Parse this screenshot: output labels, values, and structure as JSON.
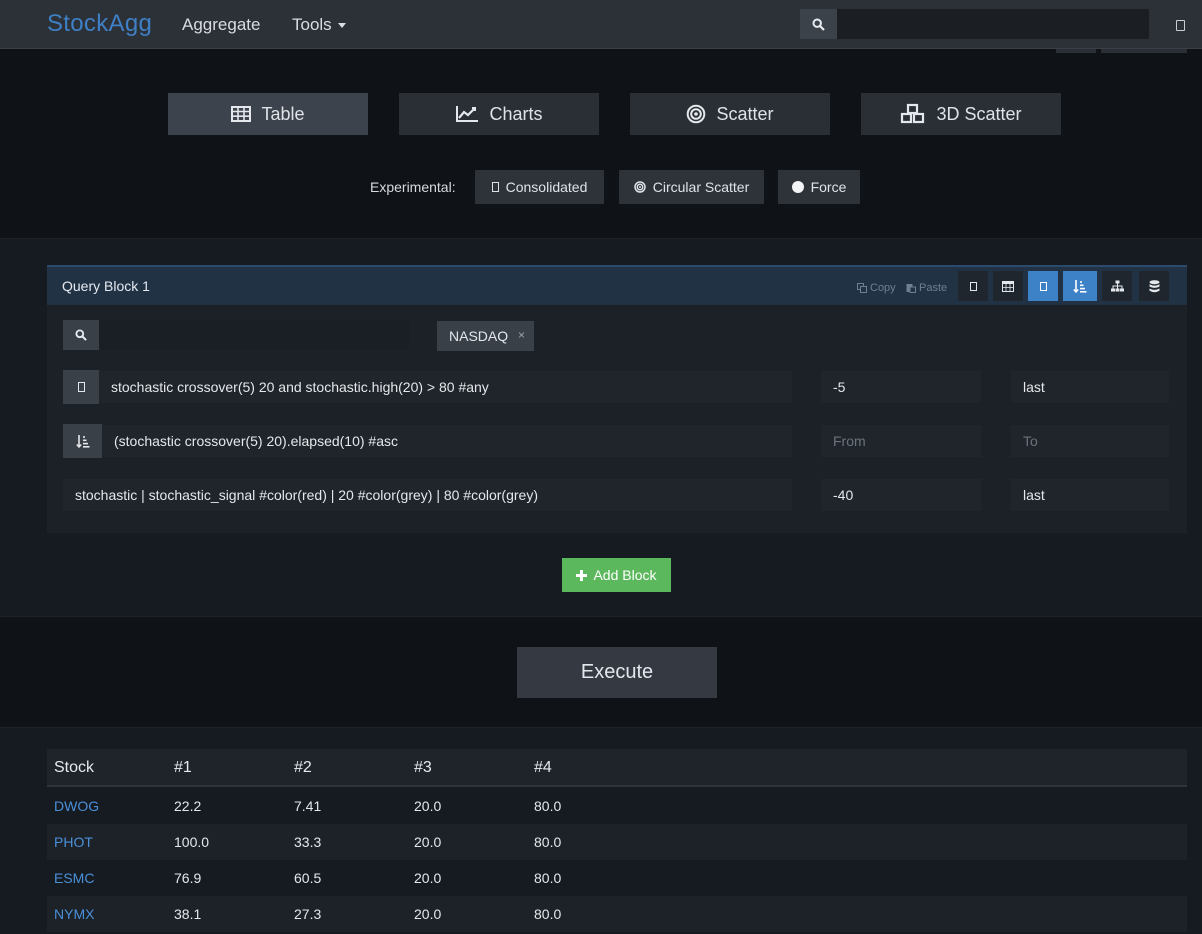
{
  "navbar": {
    "brand": "StockAgg",
    "links": [
      "Aggregate",
      "Tools"
    ],
    "search_value": ""
  },
  "views": [
    {
      "label": "Table",
      "icon": "table-icon",
      "active": true
    },
    {
      "label": "Charts",
      "icon": "line-chart-icon",
      "active": false
    },
    {
      "label": "Scatter",
      "icon": "target-icon",
      "active": false
    },
    {
      "label": "3D Scatter",
      "icon": "cubes-icon",
      "active": false
    }
  ],
  "experimental": {
    "label": "Experimental:",
    "buttons": [
      {
        "label": "Consolidated",
        "icon": "square-icon"
      },
      {
        "label": "Circular Scatter",
        "icon": "target-icon"
      },
      {
        "label": "Force",
        "icon": "circle-icon"
      }
    ]
  },
  "query_block": {
    "title": "Query Block 1",
    "copy_label": "Copy",
    "paste_label": "Paste",
    "tools": [
      {
        "icon": "square-icon",
        "active": false
      },
      {
        "icon": "calendar-icon",
        "active": false
      },
      {
        "icon": "square-icon",
        "active": true
      },
      {
        "icon": "sort-asc-icon",
        "active": true
      },
      {
        "icon": "sitemap-icon",
        "active": false
      },
      {
        "icon": "database-icon",
        "active": false
      }
    ],
    "search_value": "",
    "tag": "NASDAQ",
    "rows": [
      {
        "icon": "square-icon",
        "expression": "stochastic crossover(5) 20 and stochastic.high(20) > 80 #any",
        "from": "-5",
        "to": "last"
      },
      {
        "icon": "sort-asc-icon",
        "expression": "(stochastic crossover(5) 20).elapsed(10) #asc",
        "from_placeholder": "From",
        "to_placeholder": "To"
      },
      {
        "icon": "",
        "expression": "stochastic | stochastic_signal #color(red) | 20 #color(grey) | 80 #color(grey)",
        "from": "-40",
        "to": "last"
      }
    ]
  },
  "add_block_label": "Add Block",
  "execute_label": "Execute",
  "results": {
    "headers": [
      "Stock",
      "#1",
      "#2",
      "#3",
      "#4"
    ],
    "rows": [
      [
        "DWOG",
        "22.2",
        "7.41",
        "20.0",
        "80.0"
      ],
      [
        "PHOT",
        "100.0",
        "33.3",
        "20.0",
        "80.0"
      ],
      [
        "ESMC",
        "76.9",
        "60.5",
        "20.0",
        "80.0"
      ],
      [
        "NYMX",
        "38.1",
        "27.3",
        "20.0",
        "80.0"
      ]
    ]
  }
}
